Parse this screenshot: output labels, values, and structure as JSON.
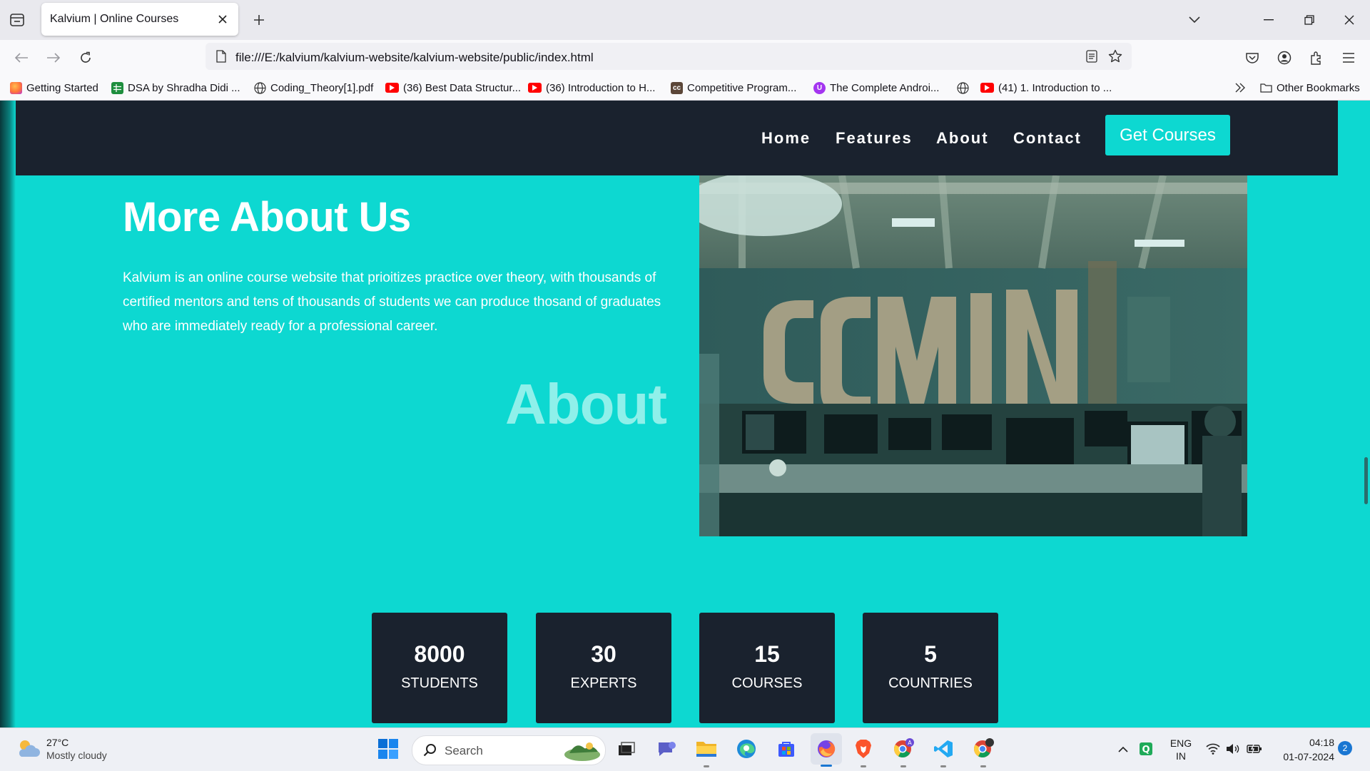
{
  "browser": {
    "tab_title": "Kalvium | Online Courses",
    "url": "file:///E:/kalvium/kalvium-website/kalvium-website/public/index.html",
    "bookmarks": [
      {
        "label": "Getting Started",
        "icon": "firefox-icon",
        "color": "#e66000"
      },
      {
        "label": "DSA by Shradha Didi ...",
        "icon": "sheets-icon",
        "color": "#1e8e3e"
      },
      {
        "label": "Coding_Theory[1].pdf",
        "icon": "globe-icon",
        "color": "#444444"
      },
      {
        "label": "(36) Best Data Structur...",
        "icon": "youtube-icon",
        "color": "#ff0000"
      },
      {
        "label": "(36) Introduction to H...",
        "icon": "youtube-icon",
        "color": "#ff0000"
      },
      {
        "label": "Competitive Program...",
        "icon": "codechef-icon",
        "color": "#5b4638"
      },
      {
        "label": "The Complete Androi...",
        "icon": "udemy-icon",
        "color": "#a435f0"
      },
      {
        "label": "",
        "icon": "globe-icon",
        "color": "#444444"
      },
      {
        "label": "(41) 1. Introduction to ...",
        "icon": "youtube-icon",
        "color": "#ff0000"
      }
    ],
    "other_bookmarks": "Other Bookmarks"
  },
  "site": {
    "nav": [
      "Home",
      "Features",
      "About",
      "Contact"
    ],
    "cta": "Get Courses",
    "accent": "#0dd8d1",
    "dark": "#1a222e"
  },
  "about": {
    "heading": "More About Us",
    "body": "Kalvium is an online course website that prioitizes practice over theory, with thousands of certified mentors and tens of thousands of students we can produce thosand of graduates who are immediately ready for a professional career.",
    "watermark": "About"
  },
  "stats": [
    {
      "value": "8000",
      "label": "STUDENTS"
    },
    {
      "value": "30",
      "label": "EXPERTS"
    },
    {
      "value": "15",
      "label": "COURSES"
    },
    {
      "value": "5",
      "label": "COUNTRIES"
    }
  ],
  "taskbar": {
    "weather_temp": "27°C",
    "weather_desc": "Mostly cloudy",
    "search_label": "Search",
    "lang_line1": "ENG",
    "lang_line2": "IN",
    "time": "04:18",
    "date": "01-07-2024",
    "notifications": "2"
  }
}
